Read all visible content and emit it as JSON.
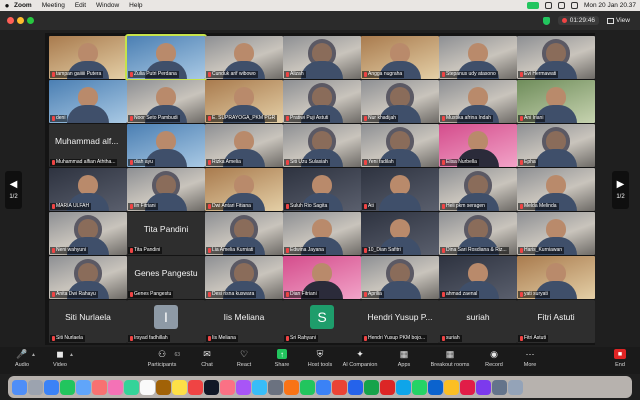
{
  "menubar": {
    "app": "Zoom",
    "items": [
      "Meeting",
      "Edit",
      "Window",
      "Help"
    ],
    "datetime": "Mon 20 Jan  20.37"
  },
  "titlebar": {
    "recording_time": "01:29:46",
    "view_label": "View"
  },
  "colors": {
    "accent_green": "#22c55e",
    "mute_red": "#ef4444",
    "active_border": "#c6e34a"
  },
  "pager": {
    "left_page": "1/2",
    "right_page": "1/2"
  },
  "participants": [
    {
      "name": "tampan gaiiiii Putera"
    },
    {
      "name": "Zulia Putri Perdana"
    },
    {
      "name": "Cunduk arif wibowo"
    },
    {
      "name": "Alizah"
    },
    {
      "name": "Angga nugraha"
    },
    {
      "name": "Stepanus udy atasono"
    },
    {
      "name": "Evi Hermawati"
    },
    {
      "name": "deni"
    },
    {
      "name": "Noor Seto Pambudi"
    },
    {
      "name": "E. SUPRAYOGA_PKM PGR"
    },
    {
      "name": "Pratiwi Puji Astuti"
    },
    {
      "name": "Nur khadijah"
    },
    {
      "name": "Mustika afrina Indah"
    },
    {
      "name": "Ani Iriani"
    },
    {
      "name": "Muhammad alfian Aththa...",
      "big": "Muhammad alf..."
    },
    {
      "name": "diah ayu"
    },
    {
      "name": "Rizka Amelia"
    },
    {
      "name": "Siti Uzu Sulasiah"
    },
    {
      "name": "Yeni fadilah"
    },
    {
      "name": "Elisa Nurbella"
    },
    {
      "name": "Epha"
    },
    {
      "name": "MARIA ULFAH"
    },
    {
      "name": "Iin Fitriani"
    },
    {
      "name": "Dwi Antari Fitiana"
    },
    {
      "name": "Suluh Rio Sagita"
    },
    {
      "name": "Ati"
    },
    {
      "name": "Heli pkm seragen"
    },
    {
      "name": "Melda Melinda"
    },
    {
      "name": "Neni wahyuni"
    },
    {
      "name": "Tita Pandini",
      "big": "Tita Pandini"
    },
    {
      "name": "Lia Amelia Kurniati"
    },
    {
      "name": "Edwina Jayana"
    },
    {
      "name": "10_Dian Safitri"
    },
    {
      "name": "Dina Sari Rosdiana & Riz..."
    },
    {
      "name": "Haris_Kurniawan"
    },
    {
      "name": "Anita Dwi Rahayu"
    },
    {
      "name": "Genes Pangestu",
      "big": "Genes Pangestu"
    },
    {
      "name": "Desi risna kuswara"
    },
    {
      "name": "Dian Fitriani"
    },
    {
      "name": "Aprilia"
    },
    {
      "name": "ahmad zaenal"
    },
    {
      "name": "yati suryati"
    },
    {
      "name": "Siti Nurlaela",
      "big": "Siti Nurlaela"
    },
    {
      "name": "Irsyad fadhillah"
    },
    {
      "name": "Iis Meliana",
      "big": "Iis Meliana"
    },
    {
      "name": "Sri Rahyani"
    },
    {
      "name": "Hendri Yusup PKM bojo...",
      "big": "Hendri Yusup P..."
    },
    {
      "name": "suriah",
      "big": "suriah"
    },
    {
      "name": "Fitri Astuti",
      "big": "Fitri Astuti"
    }
  ],
  "avatars": {
    "irsyad": "I",
    "sri": "S"
  },
  "toolbar": {
    "audio": "Audio",
    "video": "Video",
    "participants": "Participants",
    "participants_count": "63",
    "chat": "Chat",
    "react": "React",
    "share": "Share",
    "host_tools": "Host tools",
    "ai_companion": "AI Companion",
    "apps": "Apps",
    "breakout_rooms": "Breakout rooms",
    "record": "Record",
    "more": "More",
    "end": "End"
  }
}
